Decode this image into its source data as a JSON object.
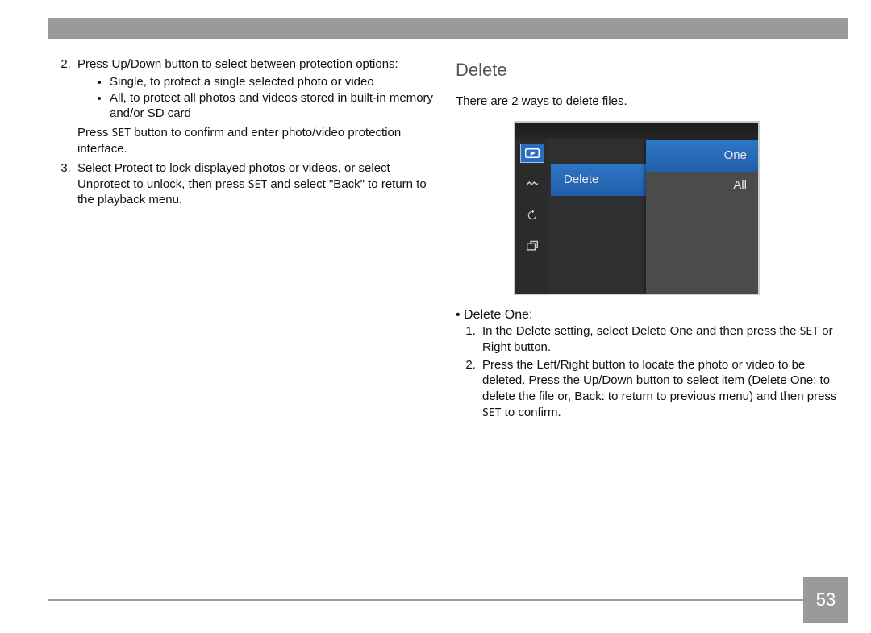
{
  "page_number": "53",
  "left": {
    "item2": "Press Up/Down button to select between protection options:",
    "bullets": [
      "Single, to protect a single selected photo or video",
      "All, to protect all photos and videos stored in built-in memory and/or SD card"
    ],
    "press_pre": "Press ",
    "set": "SET",
    "press_post": " button to confirm and enter photo/video protection interface.",
    "item3_pre": "Select Protect to lock displayed photos or videos, or select Unprotect to unlock, then press ",
    "item3_post": " and select \"Back\" to return to the playback menu."
  },
  "right": {
    "heading": "Delete",
    "intro": "There are 2 ways to delete files.",
    "lcd": {
      "menu_label": "Delete",
      "option_one": "One",
      "option_all": "All"
    },
    "sub_heading": "• Delete One:",
    "step1_pre": "In the Delete setting, select Delete One and then press the ",
    "step1_post": " or Right button.",
    "step2_pre": "Press the Left/Right button to locate the photo or video to be deleted. Press the Up/Down button to select item (Delete One: to delete the file or, Back: to return to previous menu) and then press ",
    "step2_post": " to confirm."
  }
}
